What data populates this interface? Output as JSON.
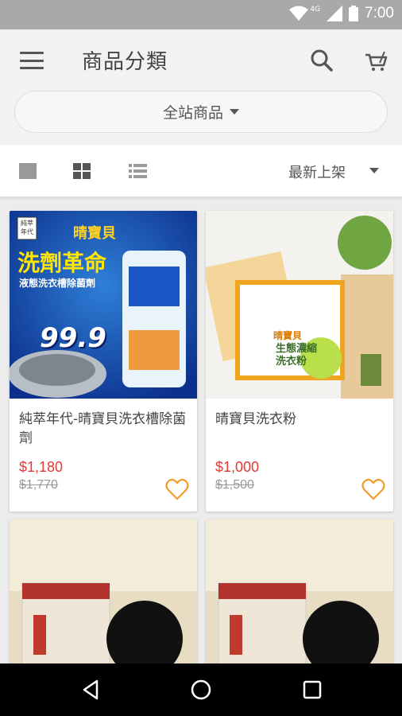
{
  "status": {
    "time": "7:00",
    "network": "4G"
  },
  "header": {
    "title": "商品分類",
    "menu_icon": "menu-icon",
    "search_icon": "search-icon",
    "cart_icon": "cart-icon"
  },
  "filter": {
    "label": "全站商品"
  },
  "toolbar": {
    "views": [
      "single-view-icon",
      "grid-view-icon",
      "list-view-icon"
    ],
    "sort_label": "最新上架"
  },
  "products": [
    {
      "title": "純萃年代-晴寶貝洗衣槽除菌劑",
      "price": "$1,180",
      "old_price": "$1,770"
    },
    {
      "title": "晴寶貝洗衣粉",
      "price": "$1,000",
      "old_price": "$1,500"
    },
    {
      "title": "",
      "price": "",
      "old_price": ""
    },
    {
      "title": "",
      "price": "",
      "old_price": ""
    }
  ],
  "product_images": {
    "p1_logo": "純萃年代",
    "p1_brand": "晴寶貝",
    "p1_headline": "洗劑革命",
    "p1_sub": "液態洗衣槽除菌劑",
    "p1_number": "99.9",
    "p2_brand": "晴寶貝",
    "p2_box_text": "生態濃縮洗衣粉"
  },
  "colors": {
    "accent": "#e53935",
    "heart": "#f39c2b",
    "status_bar": "#a9a9a9"
  }
}
